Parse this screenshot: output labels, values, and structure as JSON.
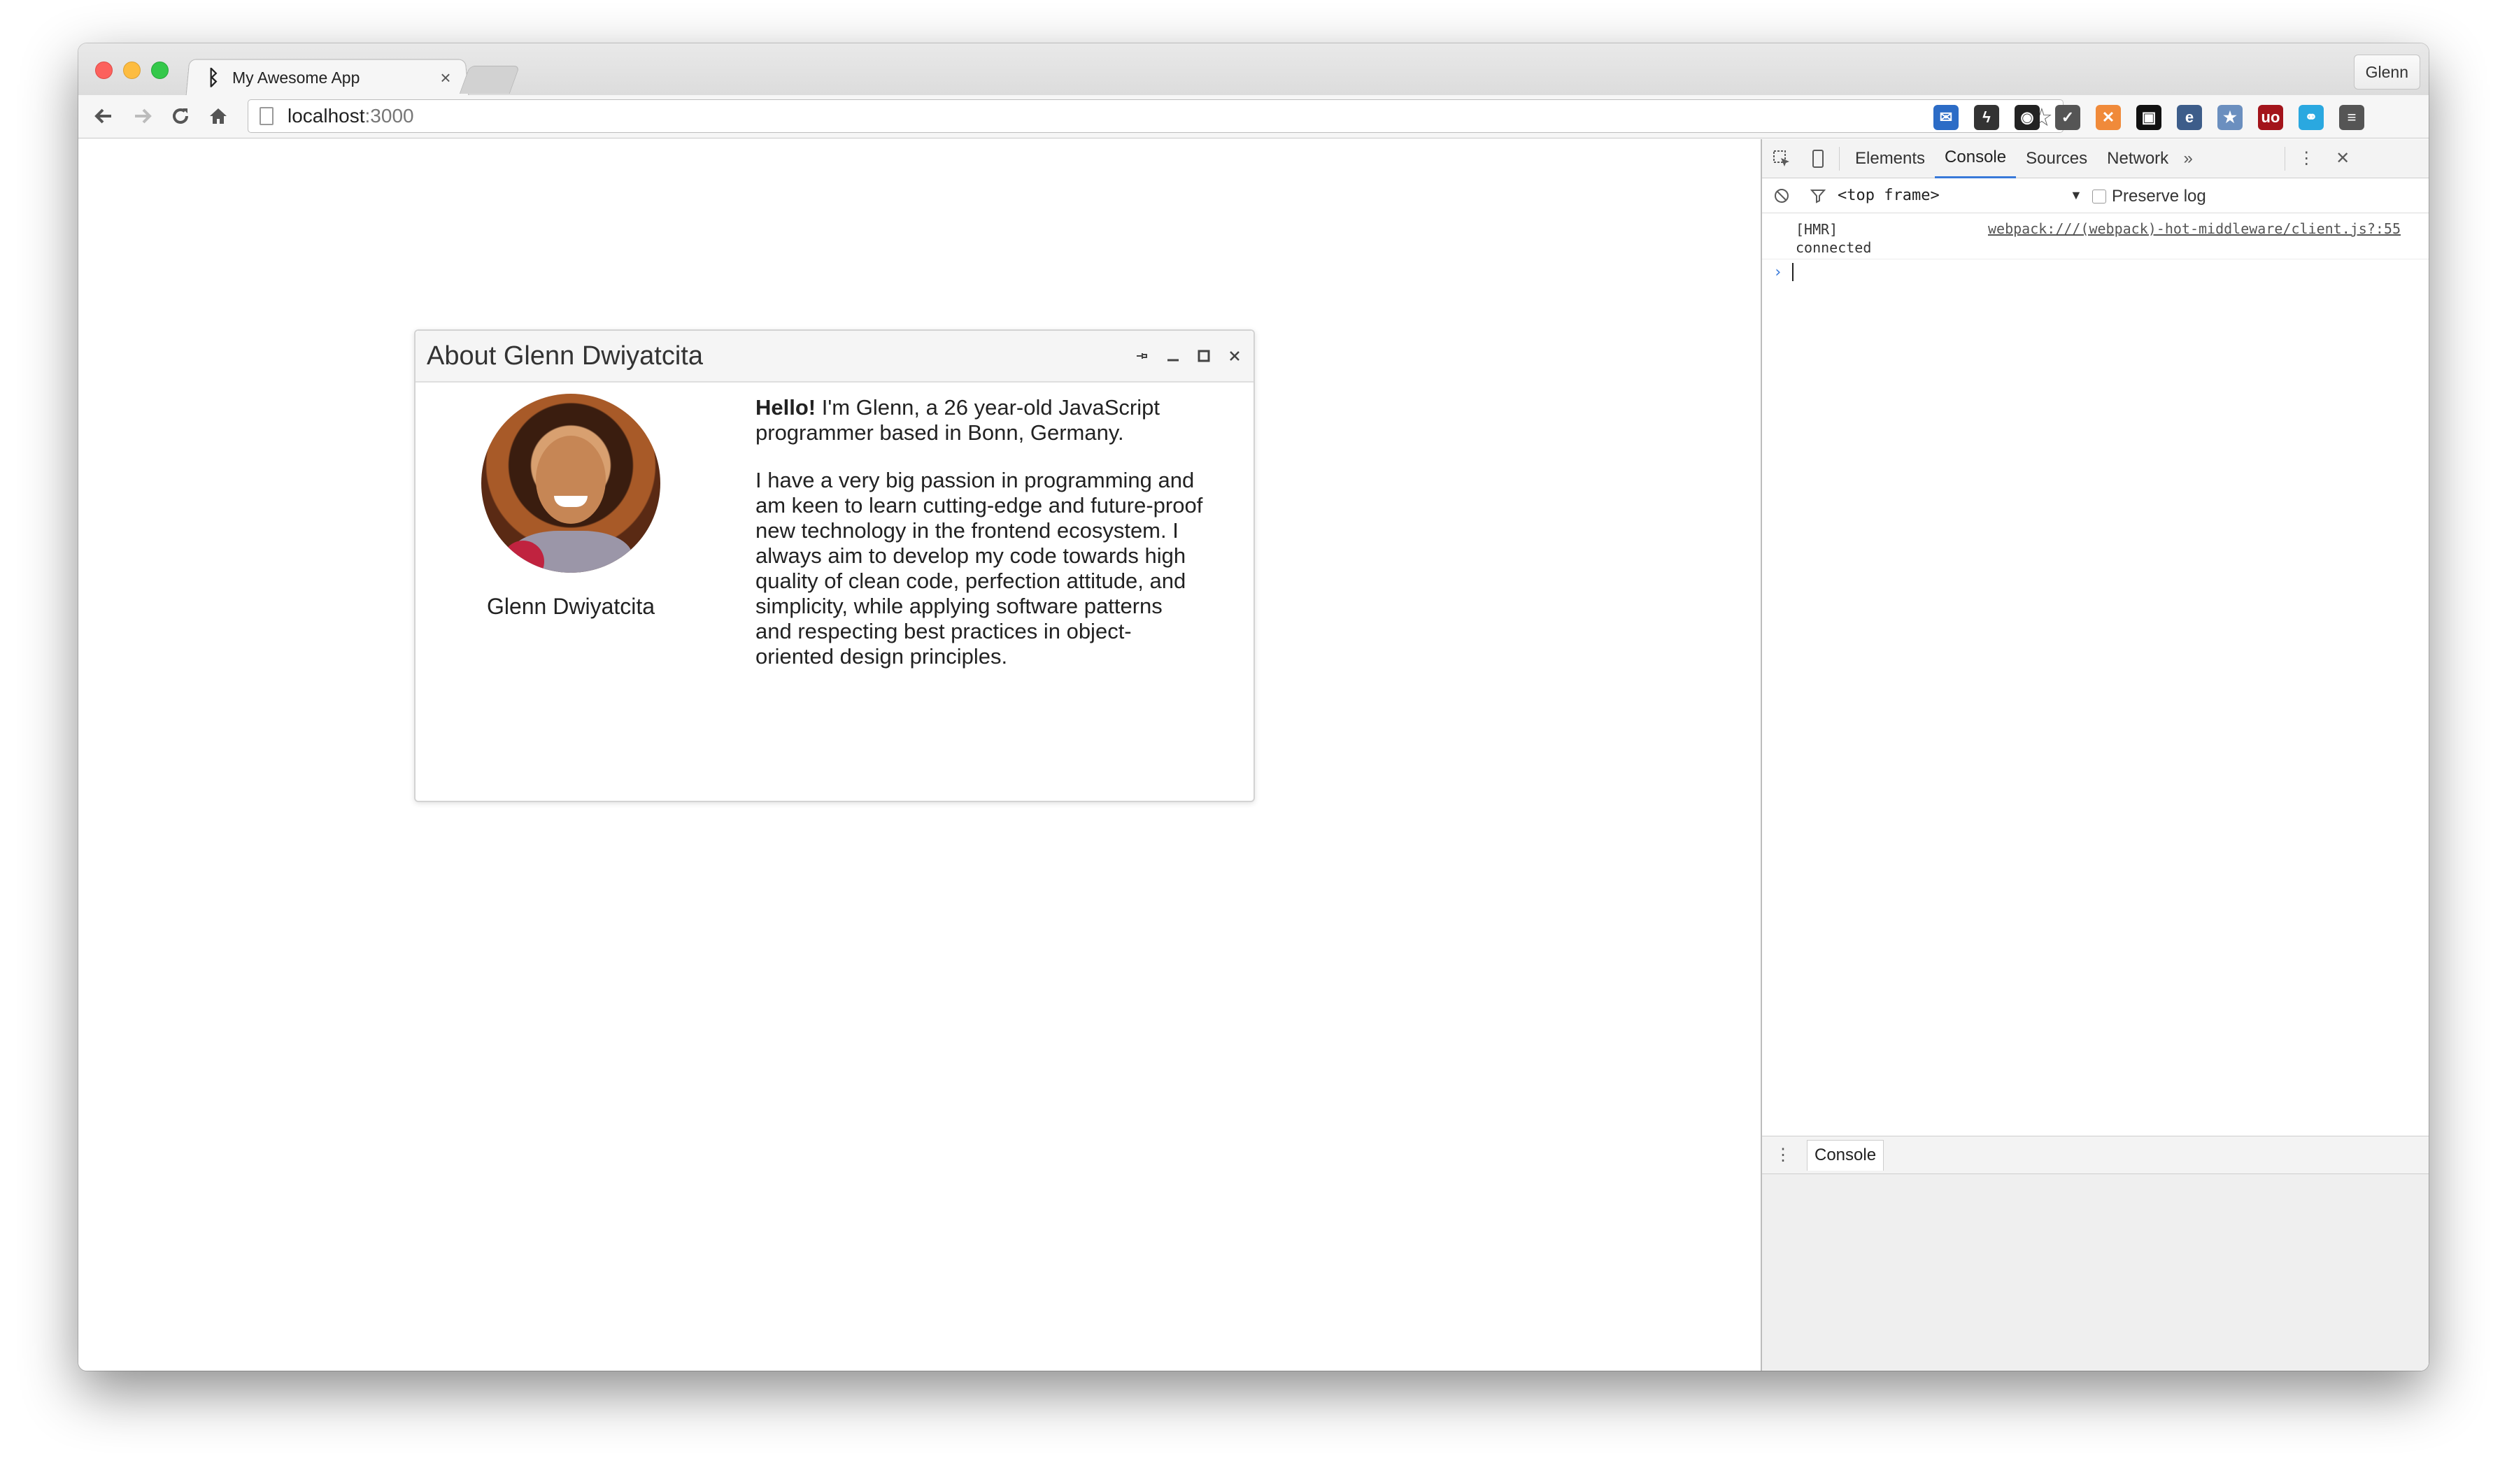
{
  "browser": {
    "tab_title": "My Awesome App",
    "tab_favicon": "b-logo-icon",
    "profile_name": "Glenn",
    "url_host": "localhost",
    "url_port": ":3000",
    "extensions": [
      {
        "name": "mail-icon",
        "color": "#2c6cc6"
      },
      {
        "name": "lightning-icon",
        "color": "#333333"
      },
      {
        "name": "eyes-icon",
        "color": "#222222"
      },
      {
        "name": "pocket-icon",
        "color": "#555555"
      },
      {
        "name": "orange-ext-icon",
        "color": "#f08a3a"
      },
      {
        "name": "lock-icon",
        "color": "#111111"
      },
      {
        "name": "e-badge-icon",
        "color": "#3d5d8a"
      },
      {
        "name": "star-square-icon",
        "color": "#6b8fbf"
      },
      {
        "name": "ublock-icon",
        "color": "#a3141b"
      },
      {
        "name": "share-icon",
        "color": "#2aa8e0"
      },
      {
        "name": "menu-icon",
        "color": "#555555"
      }
    ]
  },
  "dialog": {
    "title": "About Glenn Dwiyatcita",
    "avatar_name": "Glenn Dwiyatcita",
    "bio_bold": "Hello!",
    "bio_intro": " I'm Glenn, a 26 year-old JavaScript programmer based in Bonn, Germany.",
    "bio_paragraph": "I have a very big passion in programming and am keen to learn cutting-edge and future-proof new technology in the frontend ecosystem. I always aim to develop my code towards high quality of clean code, perfection attitude, and simplicity, while applying software patterns and respecting best practices in object-oriented design principles."
  },
  "devtools": {
    "tabs": [
      "Elements",
      "Console",
      "Sources",
      "Network"
    ],
    "active_tab": "Console",
    "context": "<top frame>",
    "preserve_log": "Preserve log",
    "messages": [
      {
        "text": "[HMR] connected",
        "source": "webpack:///(webpack)-hot-middleware/client.js?:55"
      }
    ],
    "drawer_tab": "Console",
    "accent_color": "#3879d9"
  }
}
